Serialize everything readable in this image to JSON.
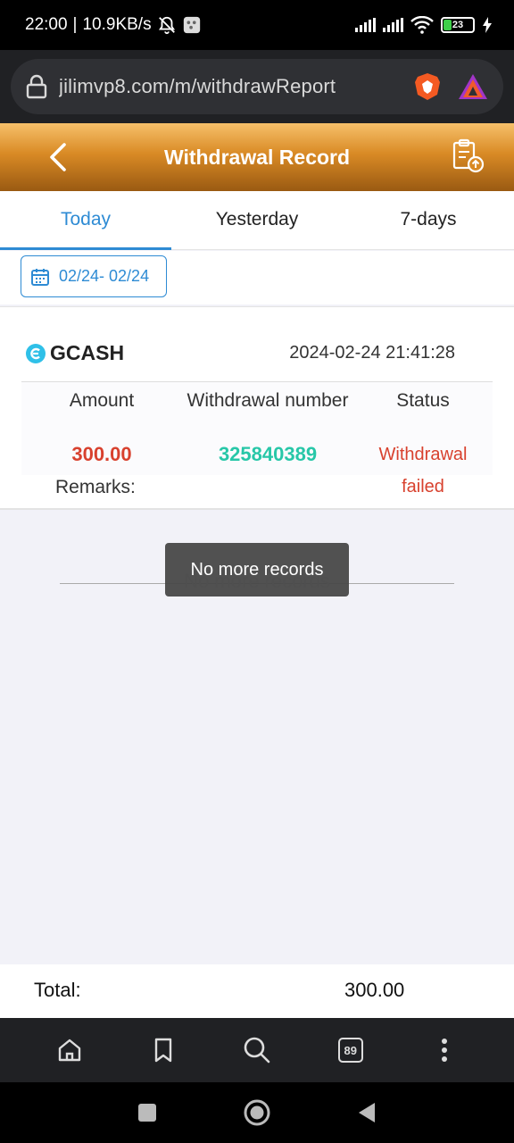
{
  "status_bar": {
    "time": "22:00",
    "separator": "|",
    "speed": "10.9KB/s",
    "battery": "23"
  },
  "browser": {
    "url": "jilimvp8.com/m/withdrawReport",
    "tab_count": "89"
  },
  "header": {
    "title": "Withdrawal Record"
  },
  "tabs": [
    {
      "label": "Today",
      "active": true
    },
    {
      "label": "Yesterday",
      "active": false
    },
    {
      "label": "7-days",
      "active": false
    }
  ],
  "date_range": "02/24- 02/24",
  "record": {
    "method": "GCASH",
    "datetime": "2024-02-24 21:41:28",
    "headers": {
      "amount": "Amount",
      "number": "Withdrawal number",
      "status": "Status"
    },
    "amount": "300.00",
    "number": "325840389",
    "status_line1": "Withdrawal",
    "status_line2": "failed",
    "remarks_label": "Remarks:"
  },
  "footer_note": "No more records",
  "toast": "No more records",
  "total": {
    "label": "Total:",
    "value": "300.00"
  },
  "colors": {
    "accent": "#2e8bd4",
    "danger": "#d8412e",
    "teal": "#27c7a8",
    "header_top": "#f6c06a",
    "header_bottom": "#9a5a12"
  }
}
